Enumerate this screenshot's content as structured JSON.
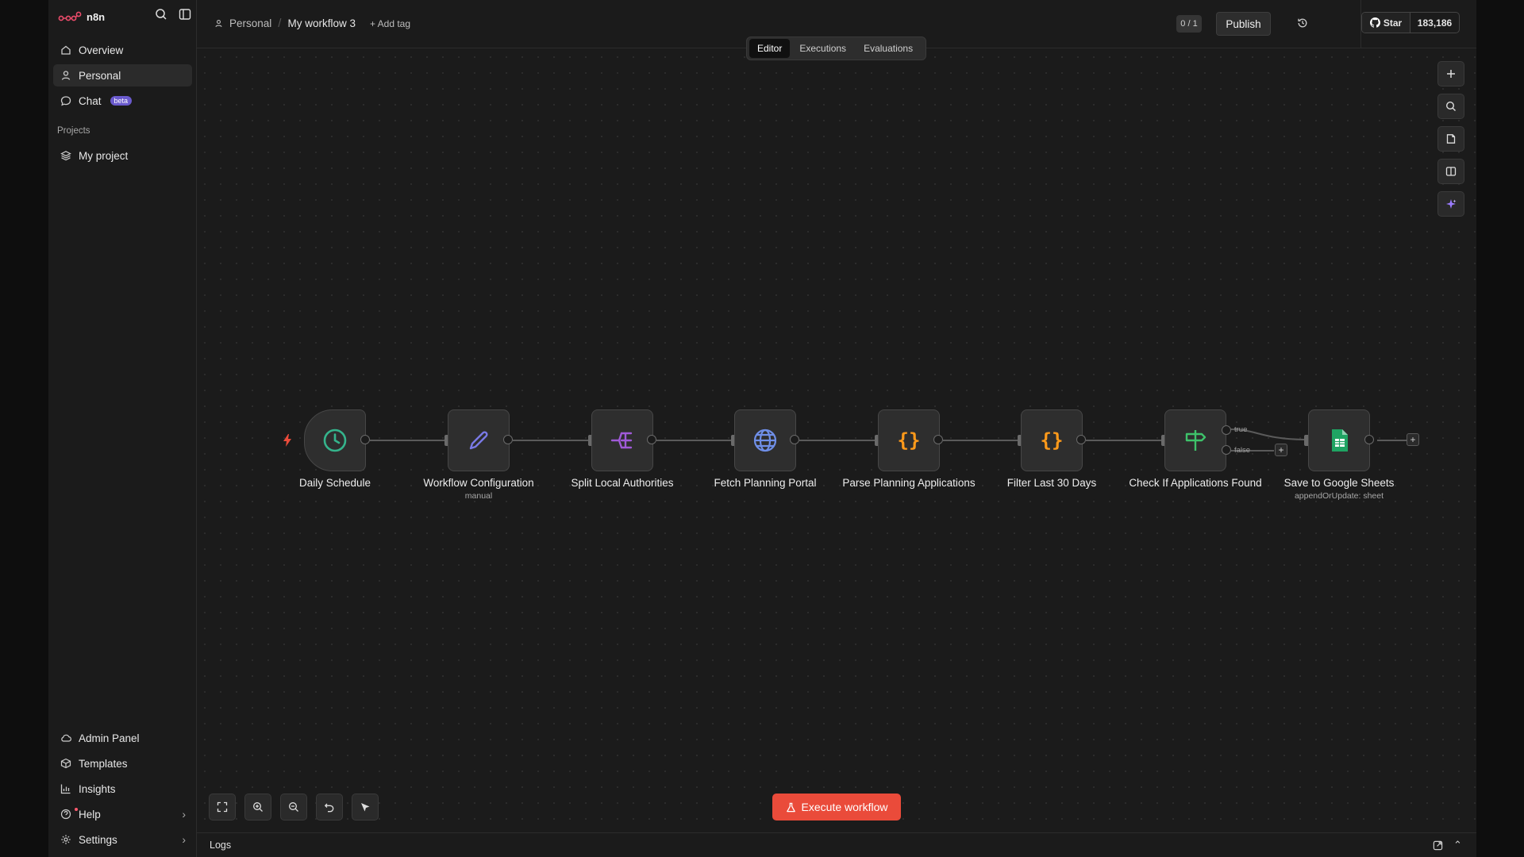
{
  "app": {
    "name": "n8n"
  },
  "sidebar": {
    "items": [
      {
        "label": "Overview",
        "icon": "home-icon"
      },
      {
        "label": "Personal",
        "icon": "user-icon"
      },
      {
        "label": "Chat",
        "icon": "chat-icon",
        "badge": "beta"
      }
    ],
    "projects_label": "Projects",
    "projects": [
      {
        "label": "My project",
        "icon": "layers-icon"
      }
    ],
    "bottom": [
      {
        "label": "Admin Panel",
        "icon": "cloud-icon"
      },
      {
        "label": "Templates",
        "icon": "box-icon"
      },
      {
        "label": "Insights",
        "icon": "chart-icon"
      },
      {
        "label": "Help",
        "icon": "help-icon"
      },
      {
        "label": "Settings",
        "icon": "gear-icon"
      }
    ]
  },
  "header": {
    "breadcrumb_project": "Personal",
    "workflow_name": "My workflow 3",
    "add_tag": "+ Add tag",
    "counter": "0 / 1",
    "publish": "Publish",
    "github_star": "Star",
    "github_count": "183,186",
    "tabs": [
      "Editor",
      "Executions",
      "Evaluations"
    ],
    "active_tab": "Editor"
  },
  "nodes": [
    {
      "label": "Daily Schedule",
      "sub": "",
      "icon": "clock-icon"
    },
    {
      "label": "Workflow Configuration",
      "sub": "manual",
      "icon": "pencil-icon"
    },
    {
      "label": "Split Local Authorities",
      "sub": "",
      "icon": "split-icon"
    },
    {
      "label": "Fetch Planning Portal",
      "sub": "",
      "icon": "globe-icon"
    },
    {
      "label": "Parse Planning Applications",
      "sub": "",
      "icon": "code-icon"
    },
    {
      "label": "Filter Last 30 Days",
      "sub": "",
      "icon": "code-icon"
    },
    {
      "label": "Check If Applications Found",
      "sub": "",
      "icon": "signpost-icon"
    },
    {
      "label": "Save to Google Sheets",
      "sub": "appendOrUpdate: sheet",
      "icon": "google-sheets-icon"
    }
  ],
  "branches": {
    "true_label": "true",
    "false_label": "false"
  },
  "canvas": {
    "execute_label": "Execute workflow"
  },
  "logs": {
    "label": "Logs"
  },
  "colors": {
    "accent": "#ea4b3a",
    "brand": "#ea4b6a",
    "trigger_green": "#35b48c",
    "code_orange": "#ff9a1a",
    "split_purple": "#a05ad8"
  }
}
